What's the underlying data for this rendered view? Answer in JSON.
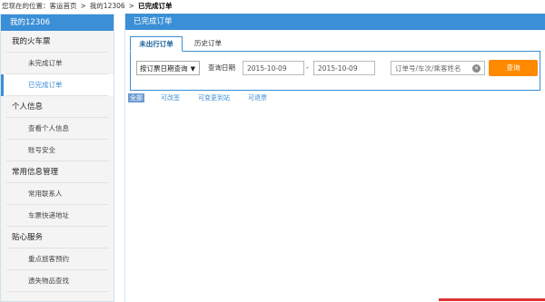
{
  "breadcrumb": {
    "prefix": "您现在的位置：",
    "items": [
      "客运首页",
      "我的12306",
      "已完成订单"
    ],
    "separator": ">"
  },
  "sidebar": {
    "title": "我的12306",
    "sections": [
      {
        "label": "我的火车票",
        "items": [
          "未完成订单",
          "已完成订单"
        ]
      },
      {
        "label": "个人信息",
        "items": [
          "查看个人信息",
          "账号安全"
        ]
      },
      {
        "label": "常用信息管理",
        "items": [
          "常用联系人",
          "车票快递地址"
        ]
      },
      {
        "label": "贴心服务",
        "items": [
          "重点旅客预约",
          "遗失物品查找"
        ]
      }
    ],
    "active_item": "已完成订单"
  },
  "main": {
    "title": "已完成订单",
    "tabs": [
      {
        "label": "未出行订单",
        "active": true
      },
      {
        "label": "历史订单",
        "active": false
      }
    ],
    "query": {
      "date_type": "按订票日期查询",
      "date_label": "查询日期",
      "start_date": "2015-10-09",
      "end_date": "2015-10-09",
      "range_separator": "-",
      "search_placeholder": "订单号/车次/乘客姓名",
      "submit_label": "查询"
    },
    "filters": [
      "全部",
      "可改签",
      "可变更到站",
      "可退票"
    ]
  },
  "colors": {
    "accent": "#3b8fd6",
    "button": "#ff8a00"
  }
}
